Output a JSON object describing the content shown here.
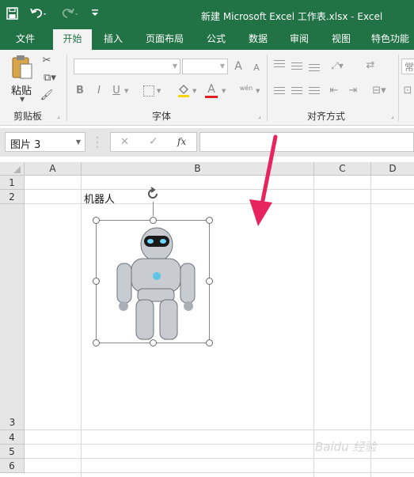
{
  "window": {
    "title": "新建 Microsoft Excel 工作表.xlsx - Excel"
  },
  "quick_access": {
    "save_icon": "save-icon",
    "undo_icon": "undo-icon",
    "redo_icon": "redo-icon",
    "customize_icon": "customize-icon"
  },
  "tabs": [
    {
      "label": "文件"
    },
    {
      "label": "开始"
    },
    {
      "label": "插入"
    },
    {
      "label": "页面布局"
    },
    {
      "label": "公式"
    },
    {
      "label": "数据"
    },
    {
      "label": "审阅"
    },
    {
      "label": "视图"
    },
    {
      "label": "特色功能"
    }
  ],
  "active_tab": "开始",
  "ribbon": {
    "clipboard": {
      "label": "剪贴板",
      "paste_label": "粘贴"
    },
    "font": {
      "label": "字体",
      "bold": "B",
      "italic": "I",
      "underline": "U",
      "font_color_letter": "A",
      "grow": "A",
      "shrink": "A",
      "phonetic": "wén"
    },
    "alignment": {
      "label": "对齐方式"
    },
    "number": {
      "partial_label": "常"
    }
  },
  "formula": {
    "name_box": "图片 3",
    "cancel": "✕",
    "enter": "✓",
    "fx": "fx",
    "value": ""
  },
  "sheet": {
    "columns": [
      "A",
      "B",
      "C",
      "D"
    ],
    "rows": [
      "1",
      "2",
      "3",
      "4",
      "5",
      "6"
    ],
    "cells": {
      "B2": "机器人"
    },
    "selected_object": "图片 3"
  },
  "colors": {
    "brand": "#217346",
    "annotation_arrow": "#e8245f"
  },
  "watermark": "Baidu 经验"
}
